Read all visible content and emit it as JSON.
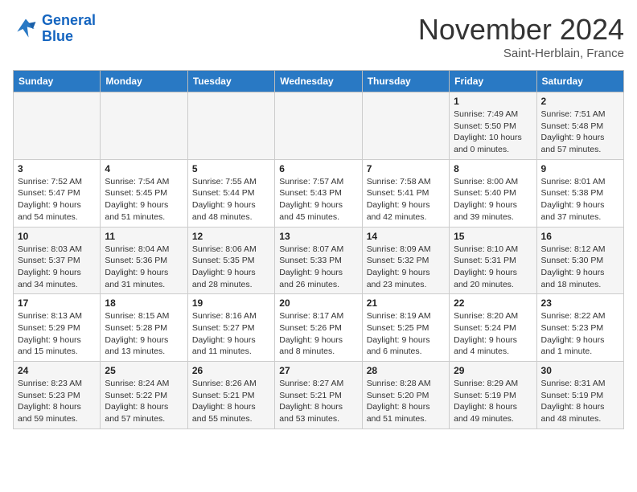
{
  "header": {
    "logo_line1": "General",
    "logo_line2": "Blue",
    "month": "November 2024",
    "location": "Saint-Herblain, France"
  },
  "weekdays": [
    "Sunday",
    "Monday",
    "Tuesday",
    "Wednesday",
    "Thursday",
    "Friday",
    "Saturday"
  ],
  "weeks": [
    [
      {
        "day": "",
        "info": ""
      },
      {
        "day": "",
        "info": ""
      },
      {
        "day": "",
        "info": ""
      },
      {
        "day": "",
        "info": ""
      },
      {
        "day": "",
        "info": ""
      },
      {
        "day": "1",
        "info": "Sunrise: 7:49 AM\nSunset: 5:50 PM\nDaylight: 10 hours\nand 0 minutes."
      },
      {
        "day": "2",
        "info": "Sunrise: 7:51 AM\nSunset: 5:48 PM\nDaylight: 9 hours\nand 57 minutes."
      }
    ],
    [
      {
        "day": "3",
        "info": "Sunrise: 7:52 AM\nSunset: 5:47 PM\nDaylight: 9 hours\nand 54 minutes."
      },
      {
        "day": "4",
        "info": "Sunrise: 7:54 AM\nSunset: 5:45 PM\nDaylight: 9 hours\nand 51 minutes."
      },
      {
        "day": "5",
        "info": "Sunrise: 7:55 AM\nSunset: 5:44 PM\nDaylight: 9 hours\nand 48 minutes."
      },
      {
        "day": "6",
        "info": "Sunrise: 7:57 AM\nSunset: 5:43 PM\nDaylight: 9 hours\nand 45 minutes."
      },
      {
        "day": "7",
        "info": "Sunrise: 7:58 AM\nSunset: 5:41 PM\nDaylight: 9 hours\nand 42 minutes."
      },
      {
        "day": "8",
        "info": "Sunrise: 8:00 AM\nSunset: 5:40 PM\nDaylight: 9 hours\nand 39 minutes."
      },
      {
        "day": "9",
        "info": "Sunrise: 8:01 AM\nSunset: 5:38 PM\nDaylight: 9 hours\nand 37 minutes."
      }
    ],
    [
      {
        "day": "10",
        "info": "Sunrise: 8:03 AM\nSunset: 5:37 PM\nDaylight: 9 hours\nand 34 minutes."
      },
      {
        "day": "11",
        "info": "Sunrise: 8:04 AM\nSunset: 5:36 PM\nDaylight: 9 hours\nand 31 minutes."
      },
      {
        "day": "12",
        "info": "Sunrise: 8:06 AM\nSunset: 5:35 PM\nDaylight: 9 hours\nand 28 minutes."
      },
      {
        "day": "13",
        "info": "Sunrise: 8:07 AM\nSunset: 5:33 PM\nDaylight: 9 hours\nand 26 minutes."
      },
      {
        "day": "14",
        "info": "Sunrise: 8:09 AM\nSunset: 5:32 PM\nDaylight: 9 hours\nand 23 minutes."
      },
      {
        "day": "15",
        "info": "Sunrise: 8:10 AM\nSunset: 5:31 PM\nDaylight: 9 hours\nand 20 minutes."
      },
      {
        "day": "16",
        "info": "Sunrise: 8:12 AM\nSunset: 5:30 PM\nDaylight: 9 hours\nand 18 minutes."
      }
    ],
    [
      {
        "day": "17",
        "info": "Sunrise: 8:13 AM\nSunset: 5:29 PM\nDaylight: 9 hours\nand 15 minutes."
      },
      {
        "day": "18",
        "info": "Sunrise: 8:15 AM\nSunset: 5:28 PM\nDaylight: 9 hours\nand 13 minutes."
      },
      {
        "day": "19",
        "info": "Sunrise: 8:16 AM\nSunset: 5:27 PM\nDaylight: 9 hours\nand 11 minutes."
      },
      {
        "day": "20",
        "info": "Sunrise: 8:17 AM\nSunset: 5:26 PM\nDaylight: 9 hours\nand 8 minutes."
      },
      {
        "day": "21",
        "info": "Sunrise: 8:19 AM\nSunset: 5:25 PM\nDaylight: 9 hours\nand 6 minutes."
      },
      {
        "day": "22",
        "info": "Sunrise: 8:20 AM\nSunset: 5:24 PM\nDaylight: 9 hours\nand 4 minutes."
      },
      {
        "day": "23",
        "info": "Sunrise: 8:22 AM\nSunset: 5:23 PM\nDaylight: 9 hours\nand 1 minute."
      }
    ],
    [
      {
        "day": "24",
        "info": "Sunrise: 8:23 AM\nSunset: 5:23 PM\nDaylight: 8 hours\nand 59 minutes."
      },
      {
        "day": "25",
        "info": "Sunrise: 8:24 AM\nSunset: 5:22 PM\nDaylight: 8 hours\nand 57 minutes."
      },
      {
        "day": "26",
        "info": "Sunrise: 8:26 AM\nSunset: 5:21 PM\nDaylight: 8 hours\nand 55 minutes."
      },
      {
        "day": "27",
        "info": "Sunrise: 8:27 AM\nSunset: 5:21 PM\nDaylight: 8 hours\nand 53 minutes."
      },
      {
        "day": "28",
        "info": "Sunrise: 8:28 AM\nSunset: 5:20 PM\nDaylight: 8 hours\nand 51 minutes."
      },
      {
        "day": "29",
        "info": "Sunrise: 8:29 AM\nSunset: 5:19 PM\nDaylight: 8 hours\nand 49 minutes."
      },
      {
        "day": "30",
        "info": "Sunrise: 8:31 AM\nSunset: 5:19 PM\nDaylight: 8 hours\nand 48 minutes."
      }
    ]
  ]
}
